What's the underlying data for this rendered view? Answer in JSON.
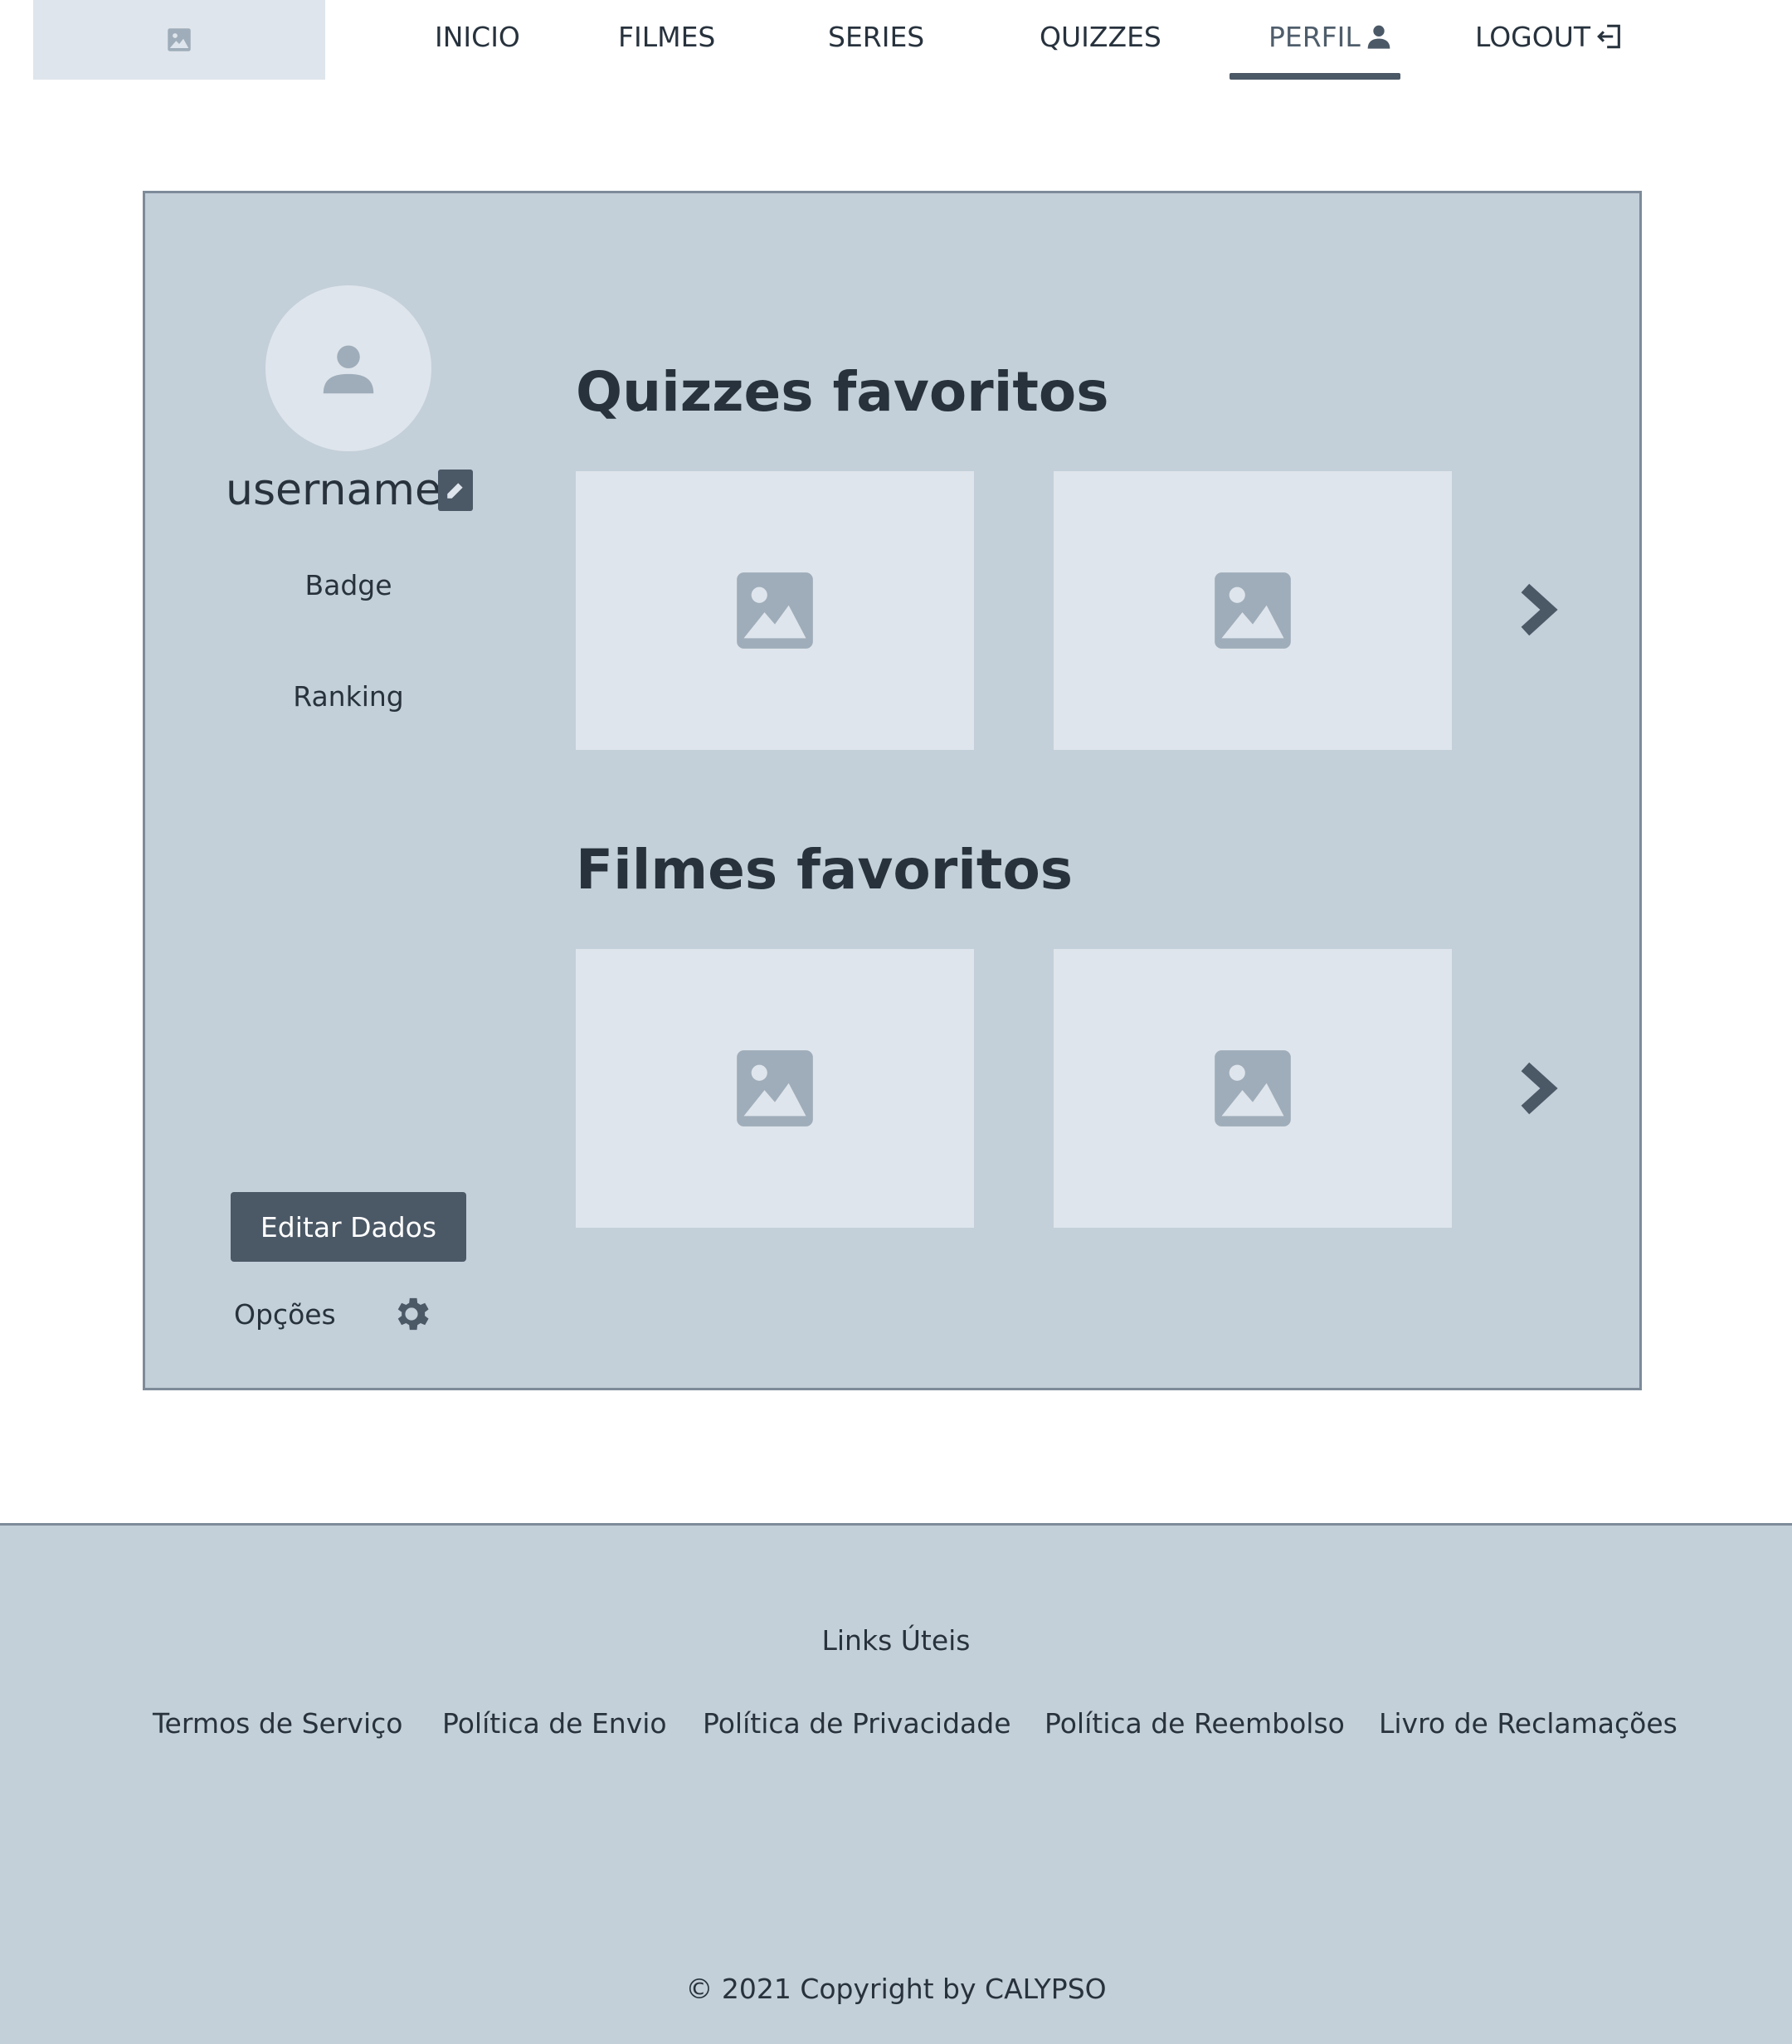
{
  "nav": {
    "logo_icon": "image-placeholder-icon",
    "items": [
      {
        "label": "INICIO"
      },
      {
        "label": "FILMES"
      },
      {
        "label": "SERIES"
      },
      {
        "label": "QUIZZES"
      },
      {
        "label": "PERFIL",
        "icon": "user-icon",
        "active": true
      },
      {
        "label": "LOGOUT",
        "icon": "logout-icon"
      }
    ]
  },
  "profile": {
    "username": "username",
    "badge": "Badge",
    "ranking": "Ranking",
    "edit_button": "Editar Dados",
    "options_label": "Opções"
  },
  "sections": {
    "quizzes_title": "Quizzes favoritos",
    "movies_title": "Filmes favoritos"
  },
  "footer": {
    "title": "Links Úteis",
    "links": [
      "Termos de Serviço",
      "Política de Envio",
      "Política de Privacidade",
      "Política de Reembolso",
      "Livro de Reclamações"
    ],
    "copyright": "© 2021 Copyright by CALYPSO"
  },
  "colors": {
    "panel": "#c3cfd9",
    "tile": "#dfe5ec",
    "accent": "#4b5866",
    "text": "#27323d"
  }
}
